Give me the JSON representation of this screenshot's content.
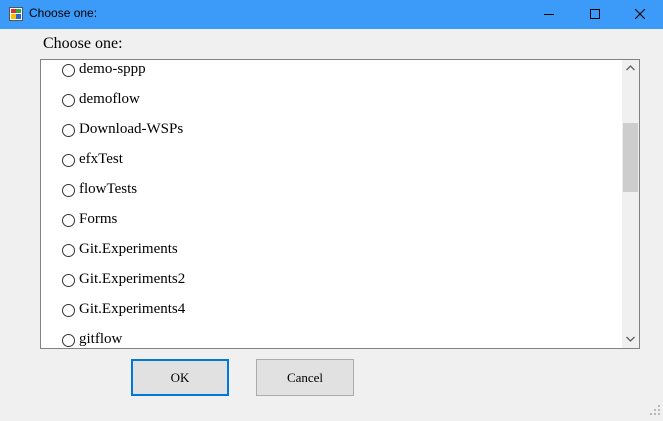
{
  "window": {
    "title": "Choose one:",
    "icon": "app-window-icon",
    "controls": [
      "minimize-icon",
      "maximize-icon",
      "close-icon"
    ]
  },
  "prompt": "Choose one:",
  "list": {
    "items": [
      {
        "label": "demo-sppp",
        "selected": false
      },
      {
        "label": "demoflow",
        "selected": false
      },
      {
        "label": "Download-WSPs",
        "selected": false
      },
      {
        "label": "efxTest",
        "selected": false
      },
      {
        "label": "flowTests",
        "selected": false
      },
      {
        "label": "Forms",
        "selected": false
      },
      {
        "label": "Git.Experiments",
        "selected": false
      },
      {
        "label": "Git.Experiments2",
        "selected": false
      },
      {
        "label": "Git.Experiments4",
        "selected": false
      },
      {
        "label": "gitflow",
        "selected": false
      }
    ]
  },
  "buttons": {
    "ok": "OK",
    "cancel": "Cancel"
  },
  "colors": {
    "titlebar": "#3c9af8",
    "focus_border": "#0078d7"
  }
}
